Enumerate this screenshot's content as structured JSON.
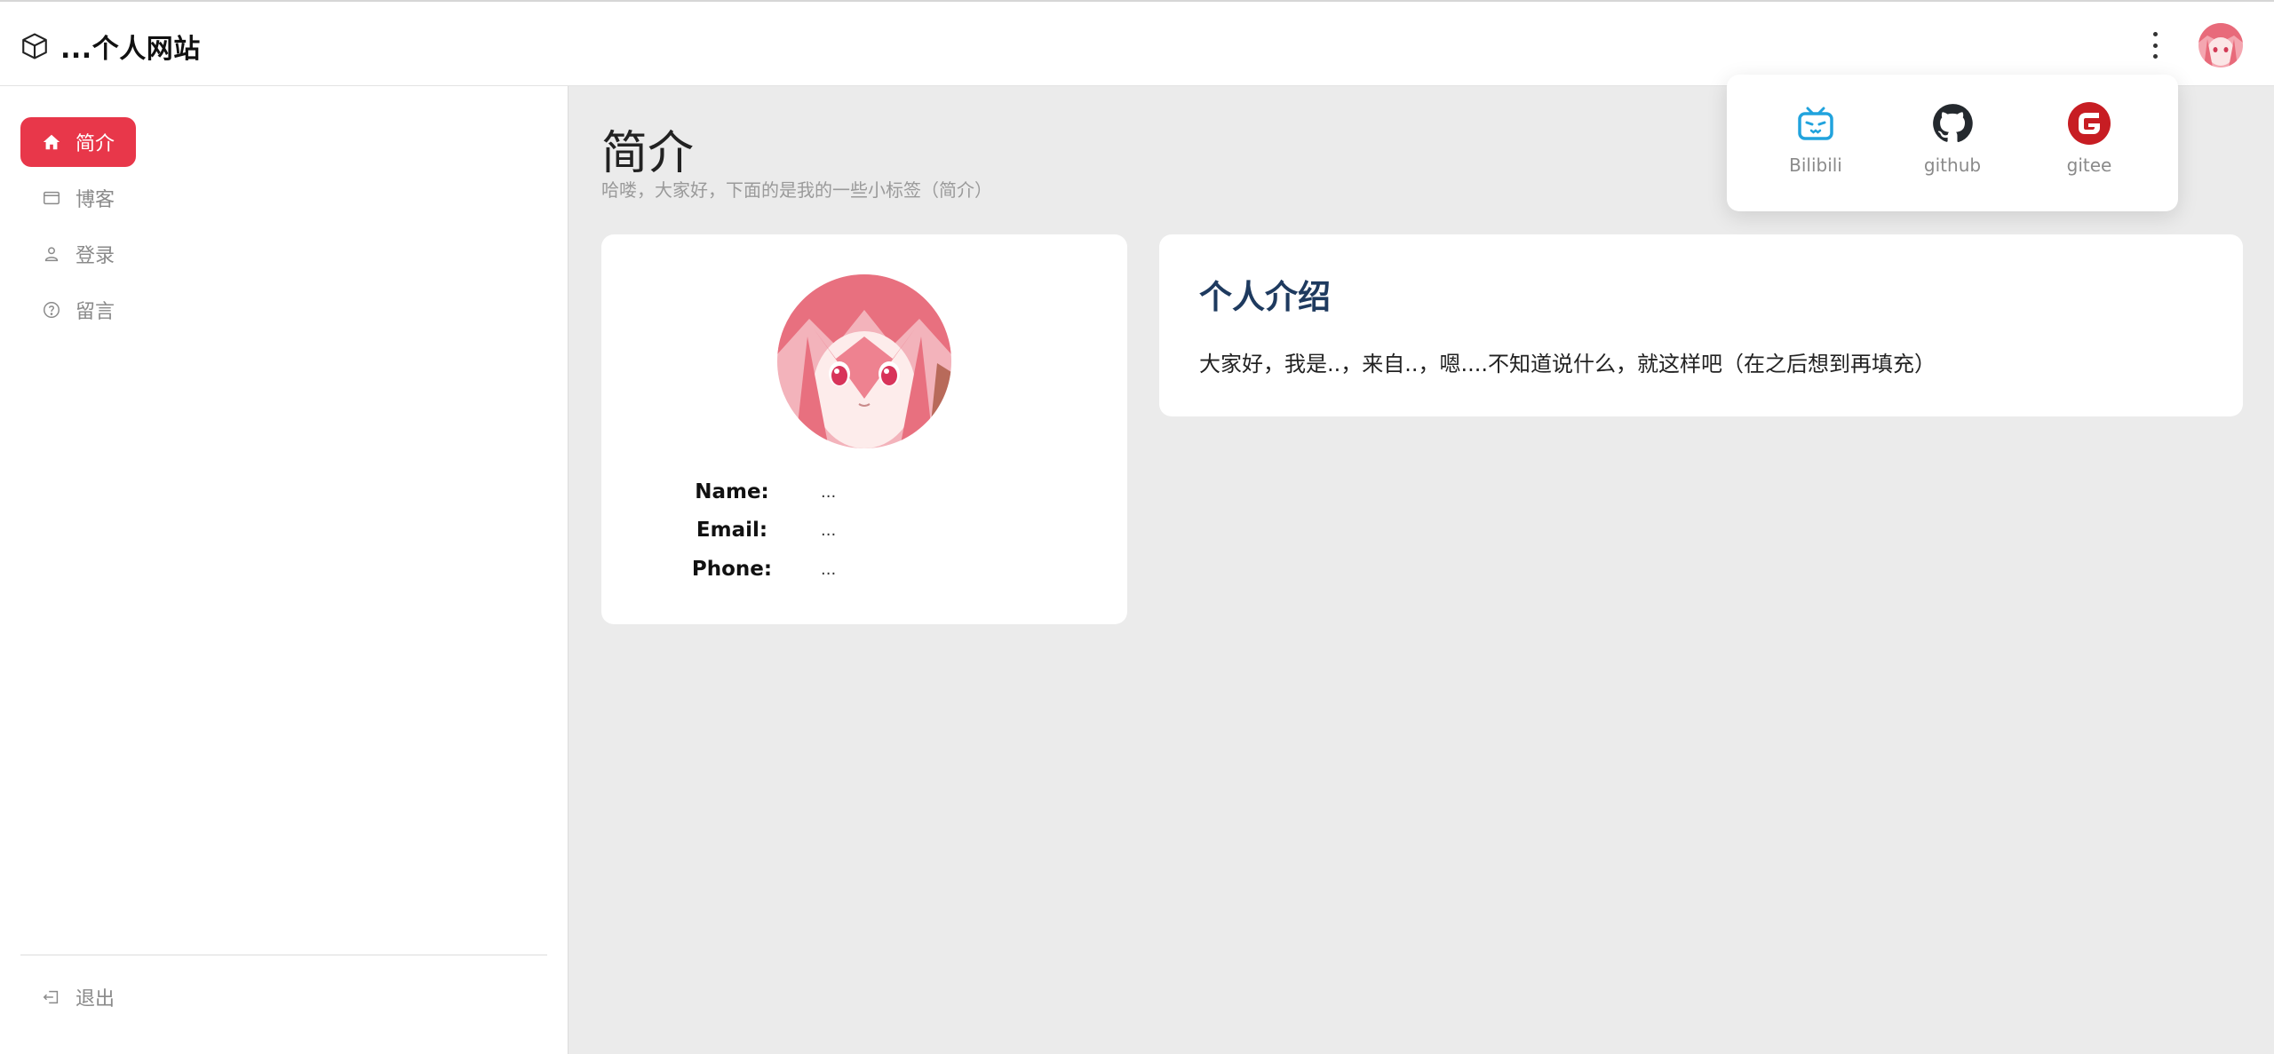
{
  "header": {
    "site_title": "...个人网站",
    "brand_icon": "cube-icon",
    "more_icon": "more-vertical-icon",
    "avatar": "anime-avatar"
  },
  "sidebar": {
    "items": [
      {
        "label": "简介",
        "icon": "home-icon",
        "active": true
      },
      {
        "label": "博客",
        "icon": "browser-window-icon",
        "active": false
      },
      {
        "label": "登录",
        "icon": "user-icon",
        "active": false
      },
      {
        "label": "留言",
        "icon": "question-circle-icon",
        "active": false
      }
    ],
    "logout_label": "退出",
    "logout_icon": "logout-icon"
  },
  "main": {
    "title": "简介",
    "subtitle": "哈喽，大家好，下面的是我的一些小标签（简介）"
  },
  "profile": {
    "name_label": "Name:",
    "name_value": "...",
    "email_label": "Email:",
    "email_value": "...",
    "phone_label": "Phone:",
    "phone_value": "..."
  },
  "intro": {
    "title": "个人介绍",
    "text": "大家好，我是..，来自..，嗯....不知道说什么，就这样吧（在之后想到再填充）"
  },
  "social": {
    "links": [
      {
        "label": "Bilibili",
        "icon": "bilibili-icon"
      },
      {
        "label": "github",
        "icon": "github-icon"
      },
      {
        "label": "gitee",
        "icon": "gitee-icon"
      }
    ]
  },
  "colors": {
    "accent": "#e8374a",
    "background": "#ebebeb",
    "intro_title": "#1e3a5f",
    "bilibili": "#21a3dd",
    "gitee": "#c71d23"
  }
}
